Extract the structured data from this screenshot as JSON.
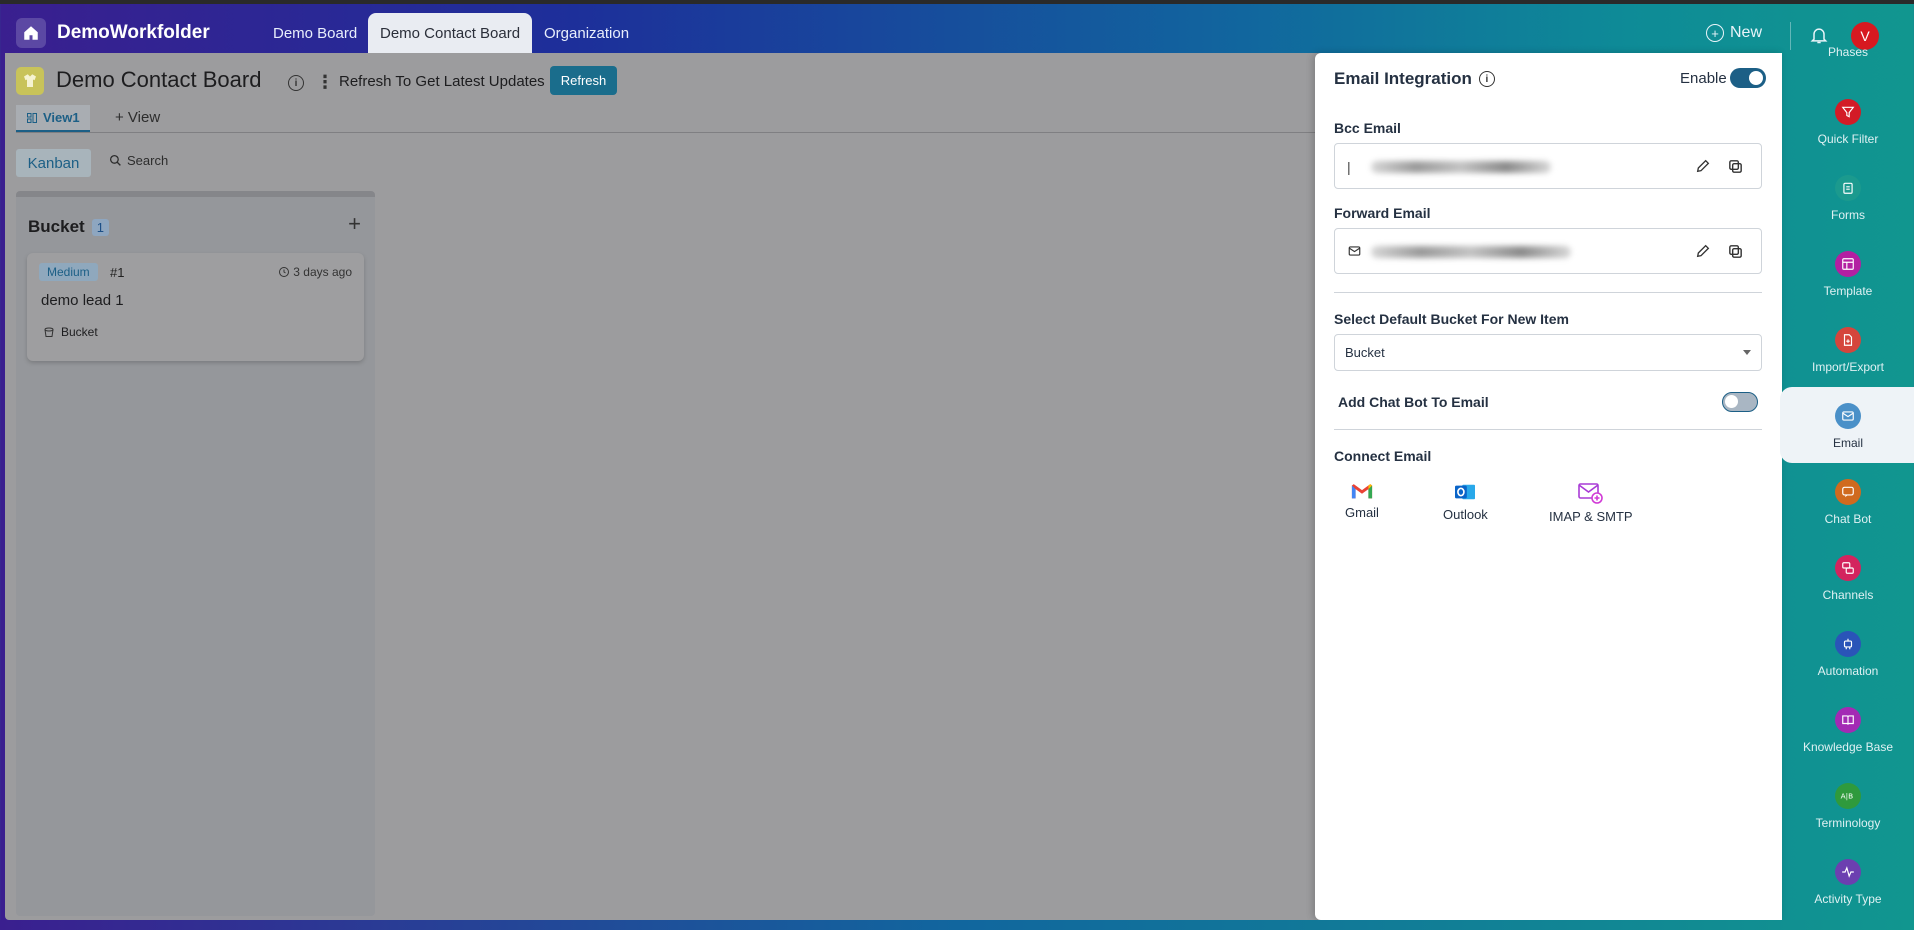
{
  "topbar": {
    "app_title": "DemoWorkfolder",
    "tabs": [
      {
        "label": "Demo Board"
      },
      {
        "label": "Demo Contact Board"
      },
      {
        "label": "Organization"
      }
    ],
    "new_label": "New",
    "avatar_initial": "V"
  },
  "board": {
    "title": "Demo Contact Board",
    "refresh_text": "Refresh To Get Latest Updates",
    "refresh_button": "Refresh",
    "view_tab": "View1",
    "add_view": "+ View",
    "kanban_label": "Kanban",
    "search_label": "Search",
    "bucket": {
      "name": "Bucket",
      "count": "1",
      "card": {
        "priority": "Medium",
        "number": "#1",
        "time": "3 days ago",
        "title": "demo lead 1",
        "bucket_label": "Bucket"
      }
    }
  },
  "email_panel": {
    "title": "Email Integration",
    "enable_label": "Enable",
    "enabled": true,
    "bcc_label": "Bcc Email",
    "forward_label": "Forward Email",
    "default_bucket_label": "Select Default Bucket For New Item",
    "default_bucket_value": "Bucket",
    "chatbot_label": "Add Chat Bot To Email",
    "chatbot_enabled": false,
    "connect_label": "Connect Email",
    "providers": [
      {
        "label": "Gmail",
        "icon": "gmail-icon"
      },
      {
        "label": "Outlook",
        "icon": "outlook-icon"
      },
      {
        "label": "IMAP & SMTP",
        "icon": "imap-icon"
      }
    ]
  },
  "right_sidebar": {
    "phases_label": "Phases",
    "items": [
      {
        "label": "Quick Filter",
        "icon": "filter-icon",
        "color": "#d31b26"
      },
      {
        "label": "Forms",
        "icon": "clipboard-icon",
        "color": "#1b9a8e"
      },
      {
        "label": "Template",
        "icon": "template-icon",
        "color": "#b31fa2"
      },
      {
        "label": "Import/Export",
        "icon": "import-export-icon",
        "color": "#d5453c"
      },
      {
        "label": "Email",
        "icon": "mail-icon",
        "color": "#4a90c8"
      },
      {
        "label": "Chat Bot",
        "icon": "chat-bot-icon",
        "color": "#d06a1e"
      },
      {
        "label": "Channels",
        "icon": "channels-icon",
        "color": "#d3245e"
      },
      {
        "label": "Automation",
        "icon": "automation-icon",
        "color": "#2a54b8"
      },
      {
        "label": "Knowledge Base",
        "icon": "book-icon",
        "color": "#a32ab4"
      },
      {
        "label": "Terminology",
        "icon": "terminology-icon",
        "color": "#2f9a3c"
      },
      {
        "label": "Activity Type",
        "icon": "activity-icon",
        "color": "#6c3fb0"
      }
    ]
  }
}
